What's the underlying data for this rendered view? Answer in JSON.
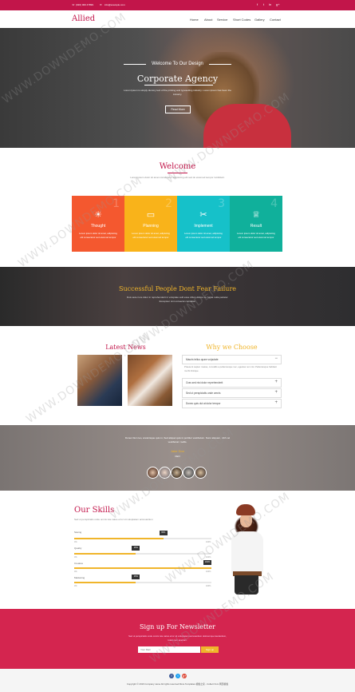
{
  "topbar": {
    "phone": "(020) 000 47899",
    "email": "info@example.com",
    "social": [
      "f",
      "t",
      "in",
      "g+"
    ]
  },
  "nav": {
    "logo": "Allied",
    "items": [
      "Home",
      "About",
      "Service",
      "Short Codes",
      "Gallery",
      "Contact"
    ]
  },
  "hero": {
    "pre_title": "Welcome To Our Design",
    "title": "Corporate Agency",
    "text": "Lorem Ipsum is simply dummy text of the printing and typesetting industry. Lorem Ipsum has been the industry.",
    "button": "Read More"
  },
  "welcome": {
    "title": "Welcome",
    "text": "Lorem ipsum dolor sit amet consectetur adipisicing elit sed do eiusmod tempor incididunt.",
    "boxes": [
      {
        "num": "1",
        "title": "Thought",
        "text": "Lorem ipsum dolor sit amet, adipiscing elit consectetur sed eiusmod tempor",
        "color": "#f4582f",
        "icon": "lightbulb-icon"
      },
      {
        "num": "2",
        "title": "Planning",
        "text": "Lorem ipsum dolor sit amet, adipiscing elit consectetur sed eiusmod tempor",
        "color": "#f9b31a",
        "icon": "chat-icon"
      },
      {
        "num": "3",
        "title": "Implement",
        "text": "Lorem ipsum dolor sit amet, adipiscing elit consectetur sed eiusmod tempor",
        "color": "#16c1c9",
        "icon": "tools-icon"
      },
      {
        "num": "4",
        "title": "Result",
        "text": "Lorem ipsum dolor sit amet, adipiscing elit consectetur sed eiusmod tempor",
        "color": "#10b09b",
        "icon": "trophy-icon"
      }
    ]
  },
  "quote": {
    "title": "Successful People Dont Fear Failure",
    "text": "Duis aute irure dolor in reprehenderit in voluptate velit esse cillum dolore eu fugiat nulla pariatur. Excepteur sint occaecat cupidatat."
  },
  "news": {
    "title": "Latest News"
  },
  "why": {
    "title": "Why we Choose",
    "items": [
      "Mauris tellus quam vulputate",
      "Cras sed nisi dolor reprehenderit",
      "Sed ut perspiciatis unde omnis",
      "Donec quis dui at dolor tempor"
    ],
    "open_text": "Praesent sapien massa, convallis a pellentesque nec, egestas non nisi. Pellentesque habitant morbi tristique."
  },
  "testimonial": {
    "text": "Donec ilium leo, scelerisque quis in, Sed aliquet quis in porttitor vestibulum. Nunc aliquam, nibh vel vestibulum mollis.",
    "name": "Jake Don",
    "role": "CEO"
  },
  "skills": {
    "title": "Our Skills",
    "subtitle": "Sed ut perspiciatis unde omnis iste natus error sit voluptatem accusantium",
    "bars": [
      {
        "label": "Saving",
        "value": 65,
        "tag": "65%"
      },
      {
        "label": "Quality",
        "value": 45,
        "tag": "45%"
      },
      {
        "label": "Creative",
        "value": 100,
        "tag": "100%"
      },
      {
        "label": "Marketing",
        "value": 45,
        "tag": "45%"
      }
    ],
    "scale_min": "0%",
    "scale_max": "100%"
  },
  "newsletter": {
    "title": "Sign up For Newsletter",
    "text": "Sed ut perspiciatis unde omnis iste natus error sit voluptatem accusantium doloremque laudantium, totam rem aperiam.",
    "placeholder": "Your Mail",
    "button": "Sign up"
  },
  "footer": {
    "social": [
      "f",
      "t",
      "g+"
    ],
    "copyright": "Copyright © 2016 Company name All rights reserved.More Templates 模板之家 - Collect from 网页模板"
  },
  "watermark": "WWW.DOWNDEMO.COM"
}
